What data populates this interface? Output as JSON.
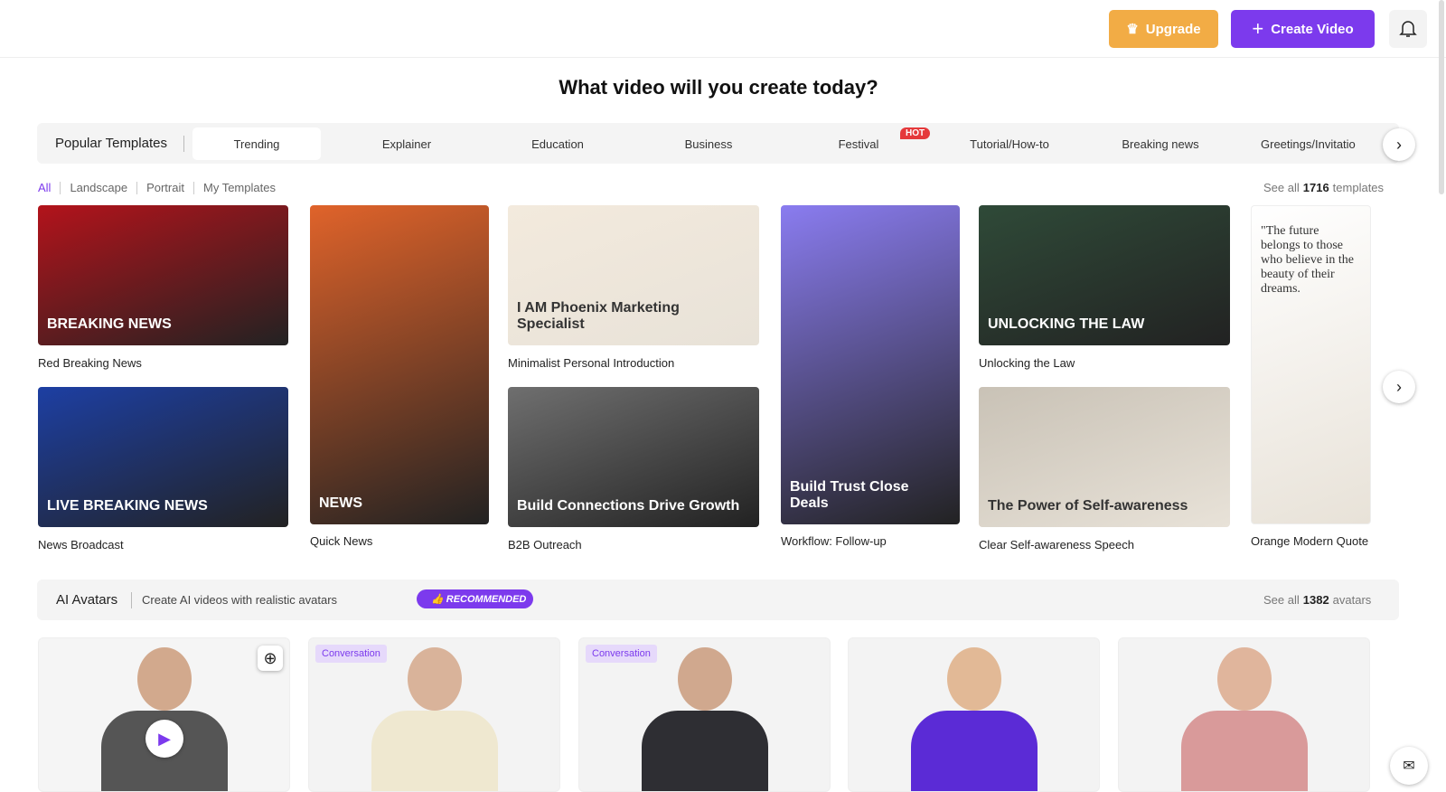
{
  "header": {
    "upgrade": "Upgrade",
    "create": "Create Video"
  },
  "title": "What video will you create today?",
  "templates": {
    "label": "Popular Templates",
    "tabs": [
      "Trending",
      "Explainer",
      "Education",
      "Business",
      "Festival",
      "Tutorial/How-to",
      "Breaking news",
      "Greetings/Invitatio"
    ],
    "hot_badge": "HOT",
    "filters": [
      "All",
      "Landscape",
      "Portrait",
      "My Templates"
    ],
    "see_all": "See all",
    "count": "1716",
    "unit": "templates",
    "cards": [
      {
        "name": "Red Breaking News",
        "overlay": "BREAKING NEWS",
        "color": "#b3131b"
      },
      {
        "name": "News Broadcast",
        "overlay": "LIVE  BREAKING NEWS",
        "color": "#1d3fa3"
      },
      {
        "name": "Quick News",
        "overlay": "NEWS",
        "color": "#e0632a"
      },
      {
        "name": "Minimalist Personal Introduction",
        "overlay": "I AM Phoenix Marketing Specialist",
        "color": "#f3eadd"
      },
      {
        "name": "B2B Outreach",
        "overlay": "Build Connections Drive Growth",
        "color": "#6f6f6f"
      },
      {
        "name": "Workflow: Follow-up",
        "overlay": "Build Trust Close Deals",
        "color": "#8a7cf0"
      },
      {
        "name": "Unlocking the Law",
        "overlay": "UNLOCKING THE LAW",
        "color": "#2f4a38"
      },
      {
        "name": "Clear Self-awareness Speech",
        "overlay": "The Power of Self-awareness",
        "color": "#c9c2b6"
      },
      {
        "name": "Orange Modern Quote",
        "overlay": "\"The future belongs to those who believe in the beauty of their dreams.",
        "color": "#fff"
      }
    ]
  },
  "avatars": {
    "label": "AI Avatars",
    "subtitle": "Create AI videos with realistic avatars",
    "recommended": "RECOMMENDED",
    "see_all": "See all",
    "count": "1382",
    "unit": "avatars",
    "badge": "Conversation"
  }
}
